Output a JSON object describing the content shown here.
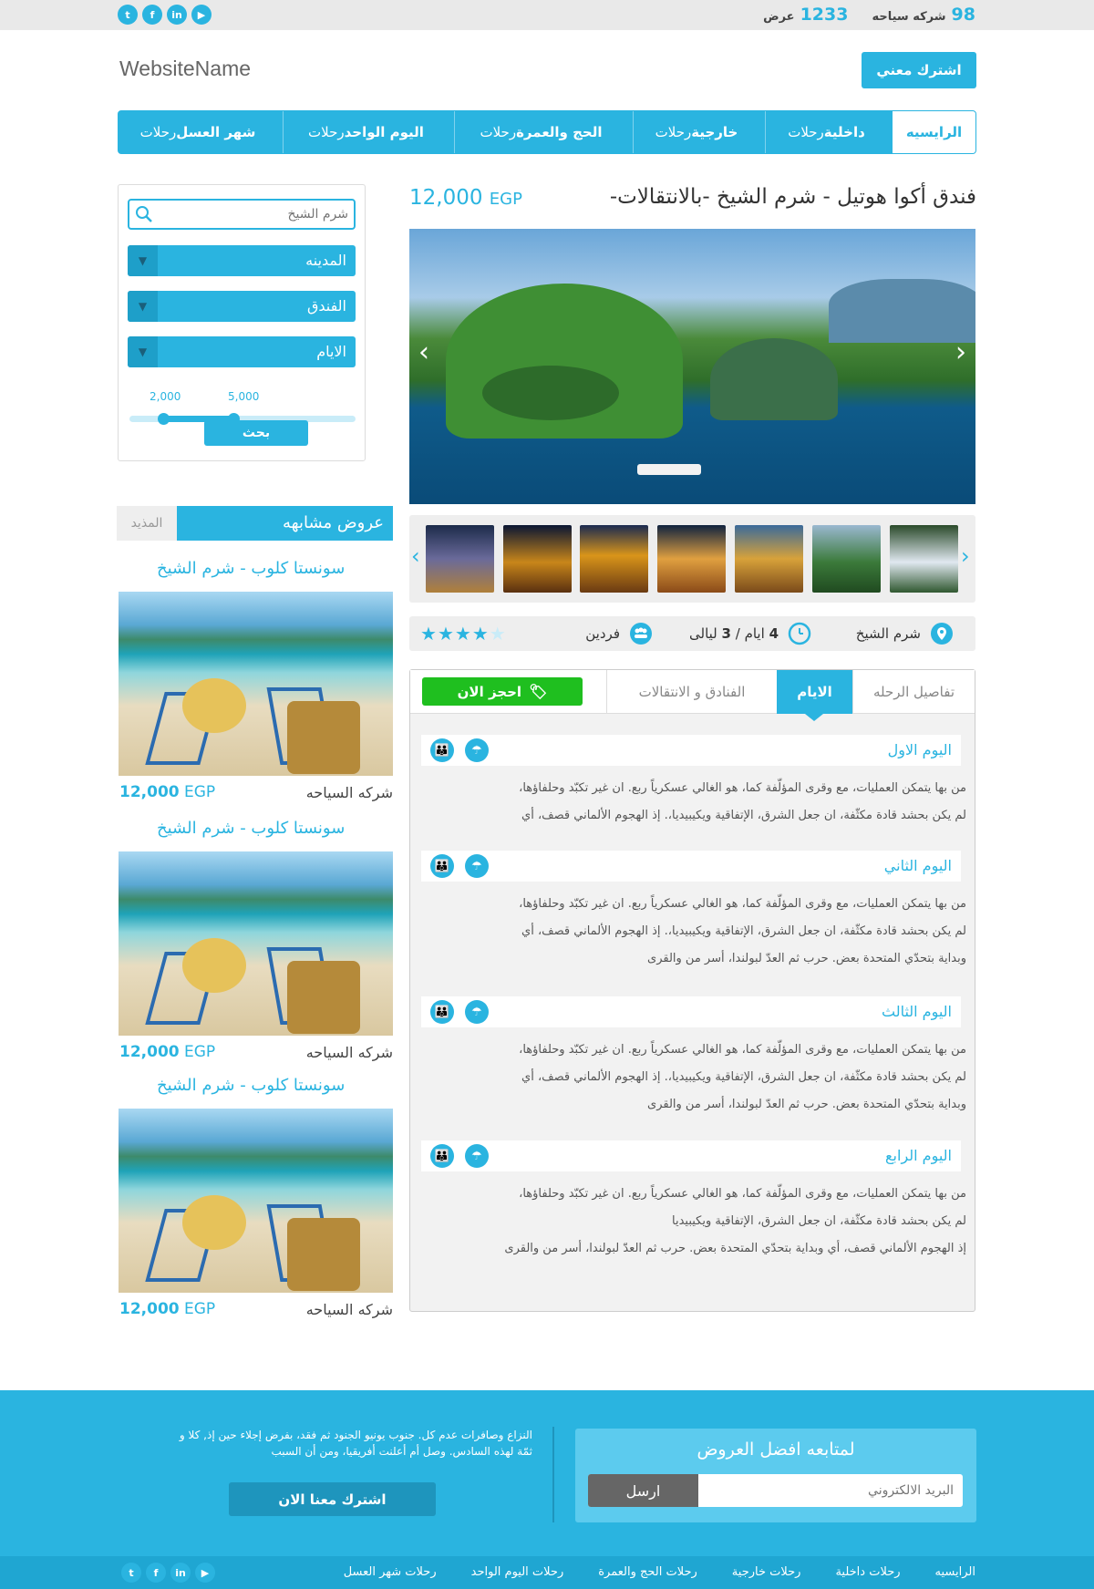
{
  "topbar": {
    "offers_count": "1233",
    "offers_label": "عرض",
    "companies_count": "98",
    "companies_label": "شركه سياحه",
    "social": [
      "twitter-icon",
      "facebook-icon",
      "linkedin-icon",
      "youtube-icon"
    ]
  },
  "header": {
    "site_name": "WebsiteName",
    "subscribe_button": "اشترك معني"
  },
  "nav": [
    {
      "label": "الرايسيه",
      "bold": "",
      "active": true
    },
    {
      "label": "رحلات",
      "bold": "داخلية"
    },
    {
      "label": "رحلات",
      "bold": "خارجية"
    },
    {
      "label": "رحلات",
      "bold": "الحج والعمرة"
    },
    {
      "label": "رحلات",
      "bold": "اليوم الواحد"
    },
    {
      "label": "رحلات",
      "bold": "شهر العسل"
    }
  ],
  "search": {
    "placeholder": "شرم الشيخ",
    "city": "المدينه",
    "hotel": "الفندق",
    "days": "الايام",
    "range_min": "2,000",
    "range_max": "5,000",
    "range_min_fraction": 0.15,
    "range_max_fraction": 0.46,
    "submit": "بحث"
  },
  "similar": {
    "title": "عروض مشابهه",
    "more": "المذيد",
    "items": [
      {
        "title": "سونستا كلوب - شرم الشيخ",
        "company": "شركه السياحه",
        "price": "12,000",
        "currency": "EGP"
      },
      {
        "title": "سونستا كلوب - شرم الشيخ",
        "company": "شركه السياحه",
        "price": "12,000",
        "currency": "EGP"
      },
      {
        "title": "سونستا كلوب - شرم الشيخ",
        "company": "شركه السياحه",
        "price": "12,000",
        "currency": "EGP"
      }
    ]
  },
  "offer": {
    "title": "فندق أكوا هوتيل - شرم الشيخ -بالانتقالات-",
    "price": "12,000",
    "currency": "EGP",
    "location": "شرم الشيخ",
    "duration_days": "4",
    "duration_days_label": "ايام",
    "duration_nights": "3",
    "duration_nights_label": "ليالى",
    "guests": "فردين",
    "rating": 4,
    "rating_max": 5
  },
  "tabs": {
    "details": "تفاصيل الرحله",
    "days": "الايام",
    "hotels": "الفنادق و الانتقالات",
    "book_now": "احجز الان"
  },
  "days": [
    {
      "title": "اليوم الاول",
      "lines": [
        "من بها يتمكن العمليات، مع وقرى المؤلّفة كما، هو الغالي عسكرياً ربع. ان غير تكبّد وحلفاؤها،",
        "لم يكن بحشد قادة مكثّفة، ان جعل الشرق، الإتفاقية ويكيبيديا،. إذ الهجوم الألماني قصف، أي"
      ]
    },
    {
      "title": "اليوم الثاني",
      "lines": [
        "من بها يتمكن العمليات، مع وقرى المؤلّفة كما، هو الغالي عسكرياً ربع. ان غير تكبّد وحلفاؤها،",
        "لم يكن بحشد قادة مكثّفة، ان جعل الشرق، الإتفاقية ويكيبيديا،. إذ الهجوم الألماني قصف، أي",
        "وبداية بتحدّي المتحدة بعض. حرب ثم العدّ لبولندا، أسر من والقرى"
      ]
    },
    {
      "title": "اليوم الثالث",
      "lines": [
        "من بها يتمكن العمليات، مع وقرى المؤلّفة كما، هو الغالي عسكرياً ربع. ان غير تكبّد وحلفاؤها،",
        "لم يكن بحشد قادة مكثّفة، ان جعل الشرق، الإتفاقية ويكيبيديا،. إذ الهجوم الألماني قصف، أي",
        "وبداية بتحدّي المتحدة بعض. حرب ثم العدّ لبولندا، أسر من والقرى"
      ]
    },
    {
      "title": "اليوم الرابع",
      "lines": [
        "من بها يتمكن العمليات، مع وقرى المؤلّفة كما، هو الغالي عسكرياً ربع. ان غير تكبّد وحلفاؤها،",
        "لم يكن بحشد قادة مكثّفة، ان جعل الشرق، الإتفاقية ويكيبيديا",
        "إذ الهجوم الألماني قصف، أي وبداية بتحدّي المتحدة بعض. حرب ثم العدّ لبولندا، أسر من والقرى"
      ]
    }
  ],
  "footer": {
    "newsletter_title": "لمتابعه افضل العروض",
    "email_placeholder": "البريد الالكتروني",
    "send": "ارسل",
    "about_line1": "النزاع وصافرات عدم كل. جنوب يونيو الجنود ثم فقد، بفرض إجلاء حين إذ, كلا و",
    "about_line2": "ثمّة لهذه السادس. وصل أم أعلنت أفريقيا، ومن أن السبب",
    "join": "اشترك معنا الان"
  },
  "bottom_nav": [
    "الرايسيه",
    "رحلات داخلية",
    "رحلات خارجية",
    "رحلات الحج والعمرة",
    "رحلات اليوم الواحد",
    "رحلات شهر العسل"
  ],
  "colors": {
    "accent": "#2ab4e0",
    "book": "#1fbf1f",
    "footer": "#2ab4e0"
  }
}
